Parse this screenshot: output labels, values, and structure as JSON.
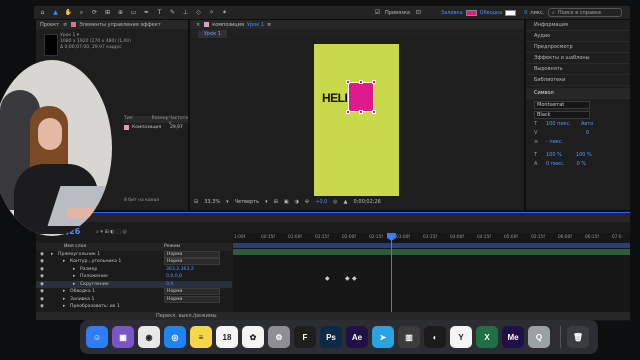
{
  "toolbar": {
    "snap_label": "Привязка",
    "fill_label": "Заливка",
    "stroke_label": "Обводка",
    "stroke_width": "0",
    "px_label": "пикс.",
    "search_placeholder": "Поиск в справке",
    "fill_color": "#e01a8c"
  },
  "project": {
    "tab_label": "Проект",
    "effects_tab": "Элементы управления эффект",
    "item_name": "Урок 1 ▾",
    "item_size": "1080 x 1920 (270 x 480) (1,00)",
    "item_duration": "Δ 0;00;07;00, 29,97 кадр/с",
    "col_name": "Имя",
    "col_type": "Тип",
    "col_size": "Размер",
    "col_rate": "Частота к",
    "row_type": "Композиция",
    "row_rate": "29,97",
    "bpc": "8 бит на канал"
  },
  "comp": {
    "tab_label": "композиция",
    "comp_name": "Урок 1",
    "subtab": "Урок 1",
    "canvas_text": "HELI",
    "canvas_color": "#c8d94a",
    "zoom": "33,3%",
    "quality": "Четверть",
    "exposure": "+0,0",
    "timecode": "0;00;02;26"
  },
  "right_panel": {
    "items": [
      "Информация",
      "Аудио",
      "Предпросмотр",
      "Эффекты и шаблоны",
      "Выровнять",
      "Библиотеки"
    ],
    "symbol_head": "Символ",
    "font": "Montserrat",
    "style": "Black",
    "size": "100 пикс.",
    "leading": "Авто",
    "tracking": "0",
    "stroke": "- пикс.",
    "scale_v": "100 %",
    "scale_h": "100 %",
    "baseline": "0 пикс.",
    "tsume": "0 %"
  },
  "timeline": {
    "time": "0;00;02;26",
    "time_short": ";26",
    "col_layer": "Имя слоя",
    "col_mode": "Режим",
    "layers": [
      {
        "name": "Прямоугольник 1",
        "mode": "Норма",
        "indent": 22
      },
      {
        "name": "Контур...угольника 1",
        "mode": "Норма",
        "indent": 34
      },
      {
        "name": "Размер",
        "value": "363,2,363,2",
        "indent": 44
      },
      {
        "name": "Положение",
        "value": "0,0,0,0",
        "indent": 44
      },
      {
        "name": "Скругление",
        "value": "0,0",
        "indent": 44,
        "selected": true
      },
      {
        "name": "Обводка 1",
        "mode": "Норма",
        "indent": 34
      },
      {
        "name": "Заливка 1",
        "mode": "Норма",
        "indent": 34
      },
      {
        "name": "Преобразовать: ик 1",
        "mode": "",
        "indent": 34
      }
    ],
    "ruler": [
      "1:00f",
      "00:15f",
      "01:00f",
      "01:15f",
      "02:00f",
      "02:15f",
      "03:00f",
      "03:15f",
      "04:00f",
      "04:15f",
      "05:00f",
      "05:15f",
      "06:00f",
      "06:15f",
      "07:0"
    ],
    "bottom_label": "Перекл. выкл./режимы"
  },
  "dock": {
    "apps": [
      {
        "name": "finder",
        "label": "☺",
        "color": "#2e7cf6"
      },
      {
        "name": "launchpad",
        "label": "▦",
        "color": "#7a55c8"
      },
      {
        "name": "chrome",
        "label": "◉",
        "color": "#e8e8e8"
      },
      {
        "name": "safari",
        "label": "◎",
        "color": "#1c84f5"
      },
      {
        "name": "notes",
        "label": "≡",
        "color": "#f6d64a"
      },
      {
        "name": "calendar",
        "label": "18",
        "color": "#f5f5f5"
      },
      {
        "name": "photos",
        "label": "✿",
        "color": "#f5f5f5"
      },
      {
        "name": "system-settings",
        "label": "⚙",
        "color": "#8e8e93"
      },
      {
        "name": "figma",
        "label": "F",
        "color": "#1e1e1e"
      },
      {
        "name": "photoshop",
        "label": "Ps",
        "color": "#0a2a45"
      },
      {
        "name": "after-effects",
        "label": "Ae",
        "color": "#1f1148"
      },
      {
        "name": "telegram",
        "label": "➤",
        "color": "#2aa3e0"
      },
      {
        "name": "calculator",
        "label": "▥",
        "color": "#3c3c3c"
      },
      {
        "name": "obs",
        "label": "◐",
        "color": "#1b1b1b"
      },
      {
        "name": "yandex",
        "label": "Y",
        "color": "#f5f5f5"
      },
      {
        "name": "excel",
        "label": "X",
        "color": "#1e7145"
      },
      {
        "name": "media-encoder",
        "label": "Me",
        "color": "#1f1148"
      },
      {
        "name": "quicktime",
        "label": "Q",
        "color": "#9aa0a6"
      }
    ],
    "trash_label": "🗑"
  }
}
